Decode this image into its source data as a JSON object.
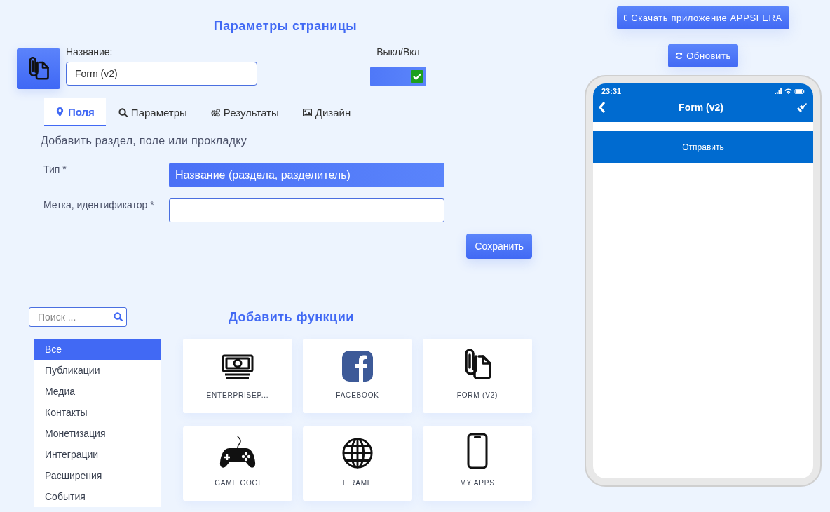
{
  "page_settings": {
    "title": "Параметры страницы",
    "name_label": "Название:",
    "name_value": "Form (v2)",
    "toggle_label": "Выкл/Вкл",
    "toggle_on": true
  },
  "tabs": [
    {
      "label": "Поля",
      "kind": "pin",
      "selected": true
    },
    {
      "label": "Параметры",
      "kind": "search",
      "selected": false
    },
    {
      "label": "Результаты",
      "kind": "gears",
      "selected": false
    },
    {
      "label": "Дизайн",
      "kind": "image",
      "selected": false
    }
  ],
  "form": {
    "heading": "Добавить раздел, поле или прокладку",
    "fields": [
      {
        "kind": "select",
        "label": "Тип *",
        "value": "Название (раздела, разделитель)"
      },
      {
        "kind": "text",
        "label": "Метка, идентификатор *"
      }
    ],
    "save_button": "Сохранить"
  },
  "functions": {
    "search": {
      "placeholder": "Поиск ..."
    },
    "title": "Добавить функции",
    "categories": [
      {
        "label": "Все",
        "selected": true
      },
      {
        "label": "Публикации",
        "selected": false
      },
      {
        "label": "Медиа",
        "selected": false
      },
      {
        "label": "Контакты",
        "selected": false
      },
      {
        "label": "Монетизация",
        "selected": false
      },
      {
        "label": "Интеграции",
        "selected": false
      },
      {
        "label": "Расширения",
        "selected": false
      },
      {
        "label": "События",
        "selected": false
      }
    ],
    "items": [
      {
        "label": "ENTERPRISEP...",
        "kind": "money"
      },
      {
        "label": "FACEBOOK",
        "kind": "facebook"
      },
      {
        "label": "FORM (V2)",
        "kind": "form"
      },
      {
        "label": "GAME GOGI",
        "kind": "gamepad"
      },
      {
        "label": "IFRAME",
        "kind": "globe"
      },
      {
        "label": "MY APPS",
        "kind": "phone"
      }
    ]
  },
  "preview": {
    "download_button": "Скачать приложение APPSFERA",
    "refresh_button": "Обновить",
    "phone": {
      "time": "23:31",
      "title": "Form (v2)",
      "submit_button": "Отправить"
    }
  }
}
